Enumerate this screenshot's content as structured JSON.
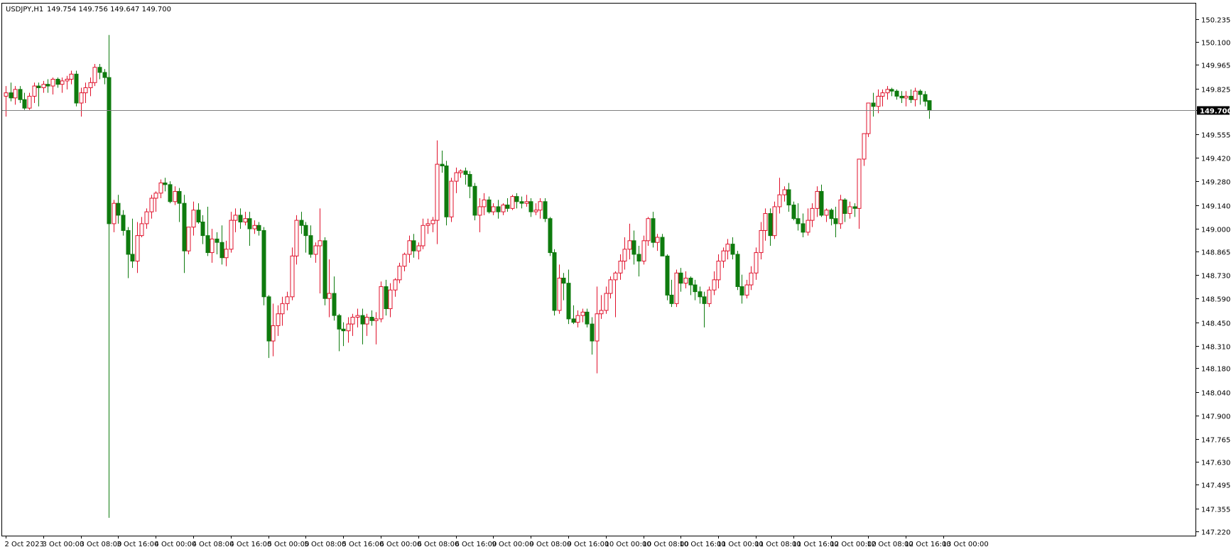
{
  "header": {
    "symbol": "USDJPY,H1",
    "ohlc": "149.754 149.756 149.647 149.700"
  },
  "colors": {
    "bull": "#e0112b",
    "bear": "#0e7b0e",
    "grid": "#000000",
    "price_line": "#808080",
    "price_tag_bg": "#000000"
  },
  "chart_data": {
    "type": "candlestick",
    "symbol": "USDJPY",
    "timeframe": "H1",
    "ylim": [
      147.22,
      150.3
    ],
    "y_ticks": [
      "150.235",
      "150.100",
      "149.965",
      "149.825",
      "149.700",
      "149.555",
      "149.420",
      "149.280",
      "149.140",
      "149.000",
      "148.865",
      "148.730",
      "148.590",
      "148.450",
      "148.310",
      "148.180",
      "148.040",
      "147.900",
      "147.765",
      "147.630",
      "147.495",
      "147.355",
      "147.220"
    ],
    "x_ticks": [
      {
        "index": 0,
        "label": "2 Oct 2023"
      },
      {
        "index": 8,
        "label": "3 Oct 00:00"
      },
      {
        "index": 16,
        "label": "3 Oct 08:00"
      },
      {
        "index": 24,
        "label": "3 Oct 16:00"
      },
      {
        "index": 32,
        "label": "4 Oct 00:00"
      },
      {
        "index": 40,
        "label": "4 Oct 08:00"
      },
      {
        "index": 48,
        "label": "4 Oct 16:00"
      },
      {
        "index": 56,
        "label": "5 Oct 00:00"
      },
      {
        "index": 64,
        "label": "5 Oct 08:00"
      },
      {
        "index": 72,
        "label": "5 Oct 16:00"
      },
      {
        "index": 80,
        "label": "6 Oct 00:00"
      },
      {
        "index": 88,
        "label": "6 Oct 08:00"
      },
      {
        "index": 96,
        "label": "6 Oct 16:00"
      },
      {
        "index": 104,
        "label": "9 Oct 00:00"
      },
      {
        "index": 112,
        "label": "9 Oct 08:00"
      },
      {
        "index": 120,
        "label": "9 Oct 16:00"
      },
      {
        "index": 128,
        "label": "10 Oct 00:00"
      },
      {
        "index": 136,
        "label": "10 Oct 08:00"
      },
      {
        "index": 144,
        "label": "10 Oct 16:00"
      },
      {
        "index": 152,
        "label": "11 Oct 00:00"
      },
      {
        "index": 160,
        "label": "11 Oct 08:00"
      },
      {
        "index": 168,
        "label": "11 Oct 16:00"
      },
      {
        "index": 176,
        "label": "12 Oct 00:00"
      },
      {
        "index": 184,
        "label": "12 Oct 08:00"
      },
      {
        "index": 192,
        "label": "12 Oct 16:00"
      },
      {
        "index": 200,
        "label": "13 Oct 00:00"
      }
    ],
    "current_price": "149.700",
    "candles": [
      [
        149.78,
        149.84,
        149.66,
        149.8
      ],
      [
        149.8,
        149.86,
        149.75,
        149.77
      ],
      [
        149.77,
        149.84,
        149.73,
        149.82
      ],
      [
        149.82,
        149.84,
        149.74,
        149.76
      ],
      [
        149.76,
        149.8,
        149.7,
        149.71
      ],
      [
        149.71,
        149.8,
        149.7,
        149.78
      ],
      [
        149.78,
        149.86,
        149.74,
        149.84
      ],
      [
        149.84,
        149.86,
        149.72,
        149.83
      ],
      [
        149.83,
        149.87,
        149.8,
        149.85
      ],
      [
        149.85,
        149.88,
        149.8,
        149.84
      ],
      [
        149.84,
        149.89,
        149.79,
        149.88
      ],
      [
        149.88,
        149.89,
        149.83,
        149.85
      ],
      [
        149.85,
        149.89,
        149.8,
        149.87
      ],
      [
        149.87,
        149.9,
        149.82,
        149.88
      ],
      [
        149.88,
        149.93,
        149.85,
        149.91
      ],
      [
        149.91,
        149.93,
        149.72,
        149.74
      ],
      [
        149.74,
        149.83,
        149.66,
        149.8
      ],
      [
        149.8,
        149.86,
        149.74,
        149.83
      ],
      [
        149.83,
        149.89,
        149.78,
        149.86
      ],
      [
        149.86,
        149.97,
        149.84,
        149.95
      ],
      [
        149.95,
        149.97,
        149.88,
        149.92
      ],
      [
        149.92,
        149.94,
        149.85,
        149.89
      ],
      [
        149.89,
        150.14,
        147.3,
        149.03
      ],
      [
        149.03,
        149.17,
        148.98,
        149.15
      ],
      [
        149.15,
        149.2,
        149.03,
        149.08
      ],
      [
        149.08,
        149.11,
        148.96,
        148.99
      ],
      [
        148.99,
        149.01,
        148.71,
        148.85
      ],
      [
        148.85,
        149.06,
        148.77,
        148.81
      ],
      [
        148.81,
        149.04,
        148.74,
        148.96
      ],
      [
        148.96,
        149.07,
        148.95,
        149.03
      ],
      [
        149.03,
        149.12,
        149.0,
        149.1
      ],
      [
        149.1,
        149.2,
        149.06,
        149.18
      ],
      [
        149.18,
        149.22,
        149.1,
        149.21
      ],
      [
        149.21,
        149.29,
        149.18,
        149.27
      ],
      [
        149.27,
        149.3,
        149.22,
        149.26
      ],
      [
        149.26,
        149.28,
        149.15,
        149.16
      ],
      [
        149.16,
        149.25,
        149.14,
        149.22
      ],
      [
        149.22,
        149.24,
        149.04,
        149.15
      ],
      [
        149.15,
        149.2,
        148.74,
        148.87
      ],
      [
        148.87,
        149.0,
        148.85,
        149.01
      ],
      [
        149.01,
        149.16,
        148.96,
        149.11
      ],
      [
        149.11,
        149.15,
        149.03,
        149.04
      ],
      [
        149.04,
        149.08,
        148.91,
        148.96
      ],
      [
        148.96,
        149.13,
        148.84,
        148.86
      ],
      [
        148.86,
        149.0,
        148.8,
        148.94
      ],
      [
        148.94,
        148.98,
        148.85,
        148.92
      ],
      [
        148.92,
        149.02,
        148.79,
        148.83
      ],
      [
        148.83,
        148.93,
        148.78,
        148.88
      ],
      [
        148.88,
        149.1,
        148.86,
        149.05
      ],
      [
        149.05,
        149.12,
        148.98,
        149.08
      ],
      [
        149.08,
        149.12,
        149.0,
        149.04
      ],
      [
        149.04,
        149.1,
        149.02,
        149.06
      ],
      [
        149.06,
        149.1,
        148.9,
        149.0
      ],
      [
        149.0,
        149.05,
        148.97,
        149.02
      ],
      [
        149.02,
        149.04,
        148.96,
        148.99
      ],
      [
        148.99,
        149.01,
        148.55,
        148.6
      ],
      [
        148.6,
        148.61,
        148.24,
        148.34
      ],
      [
        148.34,
        148.56,
        148.25,
        148.43
      ],
      [
        148.43,
        148.55,
        148.37,
        148.5
      ],
      [
        148.5,
        148.6,
        148.43,
        148.56
      ],
      [
        148.56,
        148.63,
        148.52,
        148.6
      ],
      [
        148.6,
        148.89,
        148.58,
        148.84
      ],
      [
        148.84,
        149.08,
        148.79,
        149.05
      ],
      [
        149.05,
        149.1,
        148.97,
        149.02
      ],
      [
        149.02,
        149.04,
        148.86,
        148.96
      ],
      [
        148.96,
        149.02,
        148.83,
        148.85
      ],
      [
        148.85,
        148.92,
        148.8,
        148.9
      ],
      [
        148.9,
        149.12,
        148.62,
        148.93
      ],
      [
        148.93,
        148.95,
        148.55,
        148.59
      ],
      [
        148.59,
        148.82,
        148.48,
        148.62
      ],
      [
        148.62,
        148.72,
        148.46,
        148.49
      ],
      [
        148.49,
        148.5,
        148.28,
        148.41
      ],
      [
        148.41,
        148.45,
        148.31,
        148.4
      ],
      [
        148.4,
        148.48,
        148.33,
        148.44
      ],
      [
        148.44,
        148.5,
        148.37,
        148.48
      ],
      [
        148.48,
        148.53,
        148.42,
        148.49
      ],
      [
        148.49,
        148.53,
        148.32,
        148.44
      ],
      [
        148.44,
        148.5,
        148.37,
        148.48
      ],
      [
        148.48,
        148.52,
        148.43,
        148.46
      ],
      [
        148.46,
        148.51,
        148.32,
        148.47
      ],
      [
        148.47,
        148.69,
        148.45,
        148.66
      ],
      [
        148.66,
        148.7,
        148.49,
        148.53
      ],
      [
        148.53,
        148.68,
        148.48,
        148.64
      ],
      [
        148.64,
        148.71,
        148.6,
        148.7
      ],
      [
        148.7,
        148.8,
        148.68,
        148.78
      ],
      [
        148.78,
        148.86,
        148.75,
        148.85
      ],
      [
        148.85,
        148.96,
        148.8,
        148.93
      ],
      [
        148.93,
        148.97,
        148.83,
        148.87
      ],
      [
        148.87,
        148.92,
        148.82,
        148.9
      ],
      [
        148.9,
        149.06,
        148.88,
        149.02
      ],
      [
        149.02,
        149.06,
        148.97,
        149.03
      ],
      [
        149.03,
        149.07,
        148.98,
        149.05
      ],
      [
        149.05,
        149.52,
        148.91,
        149.38
      ],
      [
        149.38,
        149.46,
        149.33,
        149.37
      ],
      [
        149.37,
        149.4,
        149.02,
        149.07
      ],
      [
        149.07,
        149.3,
        149.04,
        149.28
      ],
      [
        149.28,
        149.36,
        149.21,
        149.33
      ],
      [
        149.33,
        149.35,
        149.3,
        149.34
      ],
      [
        149.34,
        149.36,
        149.26,
        149.32
      ],
      [
        149.32,
        149.34,
        149.18,
        149.25
      ],
      [
        149.25,
        149.27,
        149.05,
        149.08
      ],
      [
        149.08,
        149.18,
        148.98,
        149.13
      ],
      [
        149.13,
        149.21,
        149.08,
        149.17
      ],
      [
        149.17,
        149.19,
        149.09,
        149.1
      ],
      [
        149.1,
        149.15,
        149.08,
        149.13
      ],
      [
        149.13,
        149.17,
        149.06,
        149.1
      ],
      [
        149.1,
        149.15,
        149.08,
        149.14
      ],
      [
        149.14,
        149.18,
        149.1,
        149.12
      ],
      [
        149.12,
        149.2,
        149.11,
        149.19
      ],
      [
        149.19,
        149.21,
        149.12,
        149.16
      ],
      [
        149.16,
        149.19,
        149.12,
        149.15
      ],
      [
        149.15,
        149.2,
        149.13,
        149.16
      ],
      [
        149.16,
        149.18,
        149.07,
        149.1
      ],
      [
        149.1,
        149.15,
        149.08,
        149.11
      ],
      [
        149.11,
        149.18,
        149.06,
        149.16
      ],
      [
        149.16,
        149.18,
        149.04,
        149.06
      ],
      [
        149.06,
        149.07,
        148.84,
        148.86
      ],
      [
        148.86,
        148.88,
        148.49,
        148.52
      ],
      [
        148.52,
        148.79,
        148.5,
        148.71
      ],
      [
        148.71,
        148.74,
        148.58,
        148.68
      ],
      [
        148.68,
        148.76,
        148.44,
        148.47
      ],
      [
        148.47,
        148.55,
        148.44,
        148.45
      ],
      [
        148.45,
        148.52,
        148.42,
        148.49
      ],
      [
        148.49,
        148.53,
        148.45,
        148.51
      ],
      [
        148.51,
        148.53,
        148.42,
        148.44
      ],
      [
        148.44,
        148.48,
        148.26,
        148.34
      ],
      [
        148.34,
        148.66,
        148.15,
        148.5
      ],
      [
        148.5,
        148.61,
        148.47,
        148.52
      ],
      [
        148.52,
        148.66,
        148.5,
        148.62
      ],
      [
        148.62,
        148.72,
        148.59,
        148.7
      ],
      [
        148.7,
        148.75,
        148.48,
        148.74
      ],
      [
        148.74,
        148.85,
        148.7,
        148.81
      ],
      [
        148.81,
        148.95,
        148.76,
        148.88
      ],
      [
        148.88,
        149.03,
        148.82,
        148.93
      ],
      [
        148.93,
        148.99,
        148.79,
        148.85
      ],
      [
        148.85,
        148.9,
        148.72,
        148.81
      ],
      [
        148.81,
        148.96,
        148.79,
        148.93
      ],
      [
        148.93,
        149.07,
        148.9,
        149.06
      ],
      [
        149.06,
        149.1,
        148.89,
        148.92
      ],
      [
        148.92,
        148.97,
        148.87,
        148.95
      ],
      [
        148.95,
        148.97,
        148.84,
        148.84
      ],
      [
        148.84,
        148.85,
        148.58,
        148.61
      ],
      [
        148.61,
        148.7,
        148.54,
        148.56
      ],
      [
        148.56,
        148.76,
        148.54,
        148.74
      ],
      [
        148.74,
        148.77,
        148.63,
        148.68
      ],
      [
        148.68,
        148.75,
        148.65,
        148.71
      ],
      [
        148.71,
        148.72,
        148.61,
        148.67
      ],
      [
        148.67,
        148.7,
        148.58,
        148.63
      ],
      [
        148.63,
        148.66,
        148.56,
        148.6
      ],
      [
        148.6,
        148.63,
        148.42,
        148.56
      ],
      [
        148.56,
        148.66,
        148.54,
        148.64
      ],
      [
        148.64,
        148.75,
        148.61,
        148.7
      ],
      [
        148.7,
        148.85,
        148.65,
        148.81
      ],
      [
        148.81,
        148.89,
        148.77,
        148.87
      ],
      [
        148.87,
        148.94,
        148.82,
        148.91
      ],
      [
        148.91,
        148.95,
        148.82,
        148.85
      ],
      [
        148.85,
        148.87,
        148.64,
        148.66
      ],
      [
        148.66,
        148.73,
        148.56,
        148.61
      ],
      [
        148.61,
        148.7,
        148.59,
        148.67
      ],
      [
        148.67,
        148.78,
        148.64,
        148.74
      ],
      [
        148.74,
        148.89,
        148.7,
        148.86
      ],
      [
        148.86,
        149.04,
        148.82,
        148.99
      ],
      [
        148.99,
        149.12,
        148.93,
        149.09
      ],
      [
        149.09,
        149.12,
        148.9,
        148.96
      ],
      [
        148.96,
        149.16,
        148.94,
        149.13
      ],
      [
        149.13,
        149.3,
        149.09,
        149.2
      ],
      [
        149.2,
        149.25,
        149.16,
        149.23
      ],
      [
        149.23,
        149.27,
        149.1,
        149.14
      ],
      [
        149.14,
        149.16,
        149.05,
        149.06
      ],
      [
        149.06,
        149.15,
        148.99,
        149.03
      ],
      [
        149.03,
        149.09,
        148.95,
        148.98
      ],
      [
        148.98,
        149.12,
        148.96,
        149.05
      ],
      [
        149.05,
        149.15,
        149.01,
        149.12
      ],
      [
        149.12,
        149.25,
        149.07,
        149.22
      ],
      [
        149.22,
        149.26,
        149.07,
        149.08
      ],
      [
        149.08,
        149.12,
        149.04,
        149.11
      ],
      [
        149.11,
        149.12,
        149.02,
        149.06
      ],
      [
        149.06,
        149.13,
        148.95,
        149.03
      ],
      [
        149.03,
        149.2,
        149.0,
        149.17
      ],
      [
        149.17,
        149.18,
        149.04,
        149.09
      ],
      [
        149.09,
        149.16,
        149.06,
        149.13
      ],
      [
        149.13,
        149.15,
        149.07,
        149.12
      ],
      [
        149.12,
        149.22,
        149.0,
        149.41
      ],
      [
        149.41,
        149.54,
        149.37,
        149.56
      ],
      [
        149.56,
        149.7,
        149.54,
        149.74
      ],
      [
        149.74,
        149.8,
        149.66,
        149.72
      ],
      [
        149.72,
        149.82,
        149.68,
        149.78
      ],
      [
        149.78,
        149.82,
        149.72,
        149.8
      ],
      [
        149.8,
        149.84,
        149.76,
        149.82
      ],
      [
        149.82,
        149.83,
        149.78,
        149.81
      ],
      [
        149.81,
        149.82,
        149.76,
        149.78
      ],
      [
        149.78,
        149.81,
        149.74,
        149.77
      ],
      [
        149.77,
        149.81,
        149.72,
        149.78
      ],
      [
        149.78,
        149.82,
        149.74,
        149.76
      ],
      [
        149.76,
        149.83,
        149.72,
        149.81
      ],
      [
        149.81,
        149.82,
        149.73,
        149.79
      ],
      [
        149.79,
        149.81,
        149.72,
        149.75
      ],
      [
        149.754,
        149.756,
        149.647,
        149.7
      ]
    ]
  }
}
